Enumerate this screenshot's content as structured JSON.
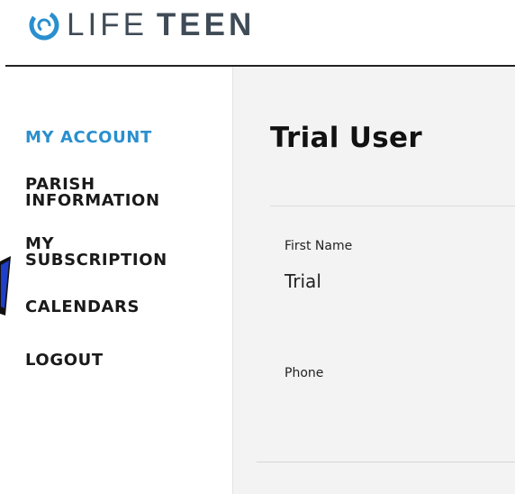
{
  "brand": {
    "logo_word1": "LIFE",
    "logo_word2": "TEEN",
    "accent_color": "#2a8fce",
    "logo_icon": "circle-swirl-icon"
  },
  "sidebar": {
    "items": [
      {
        "label": "MY ACCOUNT",
        "active": true
      },
      {
        "label_line1": "PARISH",
        "label_line2": "INFORMATION"
      },
      {
        "label_line1": "MY",
        "label_line2": "SUBSCRIPTION"
      },
      {
        "label": "CALENDARS"
      },
      {
        "label": "LOGOUT"
      }
    ]
  },
  "profile": {
    "name": "Trial User",
    "fields": [
      {
        "label": "First Name",
        "value": "Trial"
      },
      {
        "label": "Phone",
        "value": ""
      }
    ]
  }
}
